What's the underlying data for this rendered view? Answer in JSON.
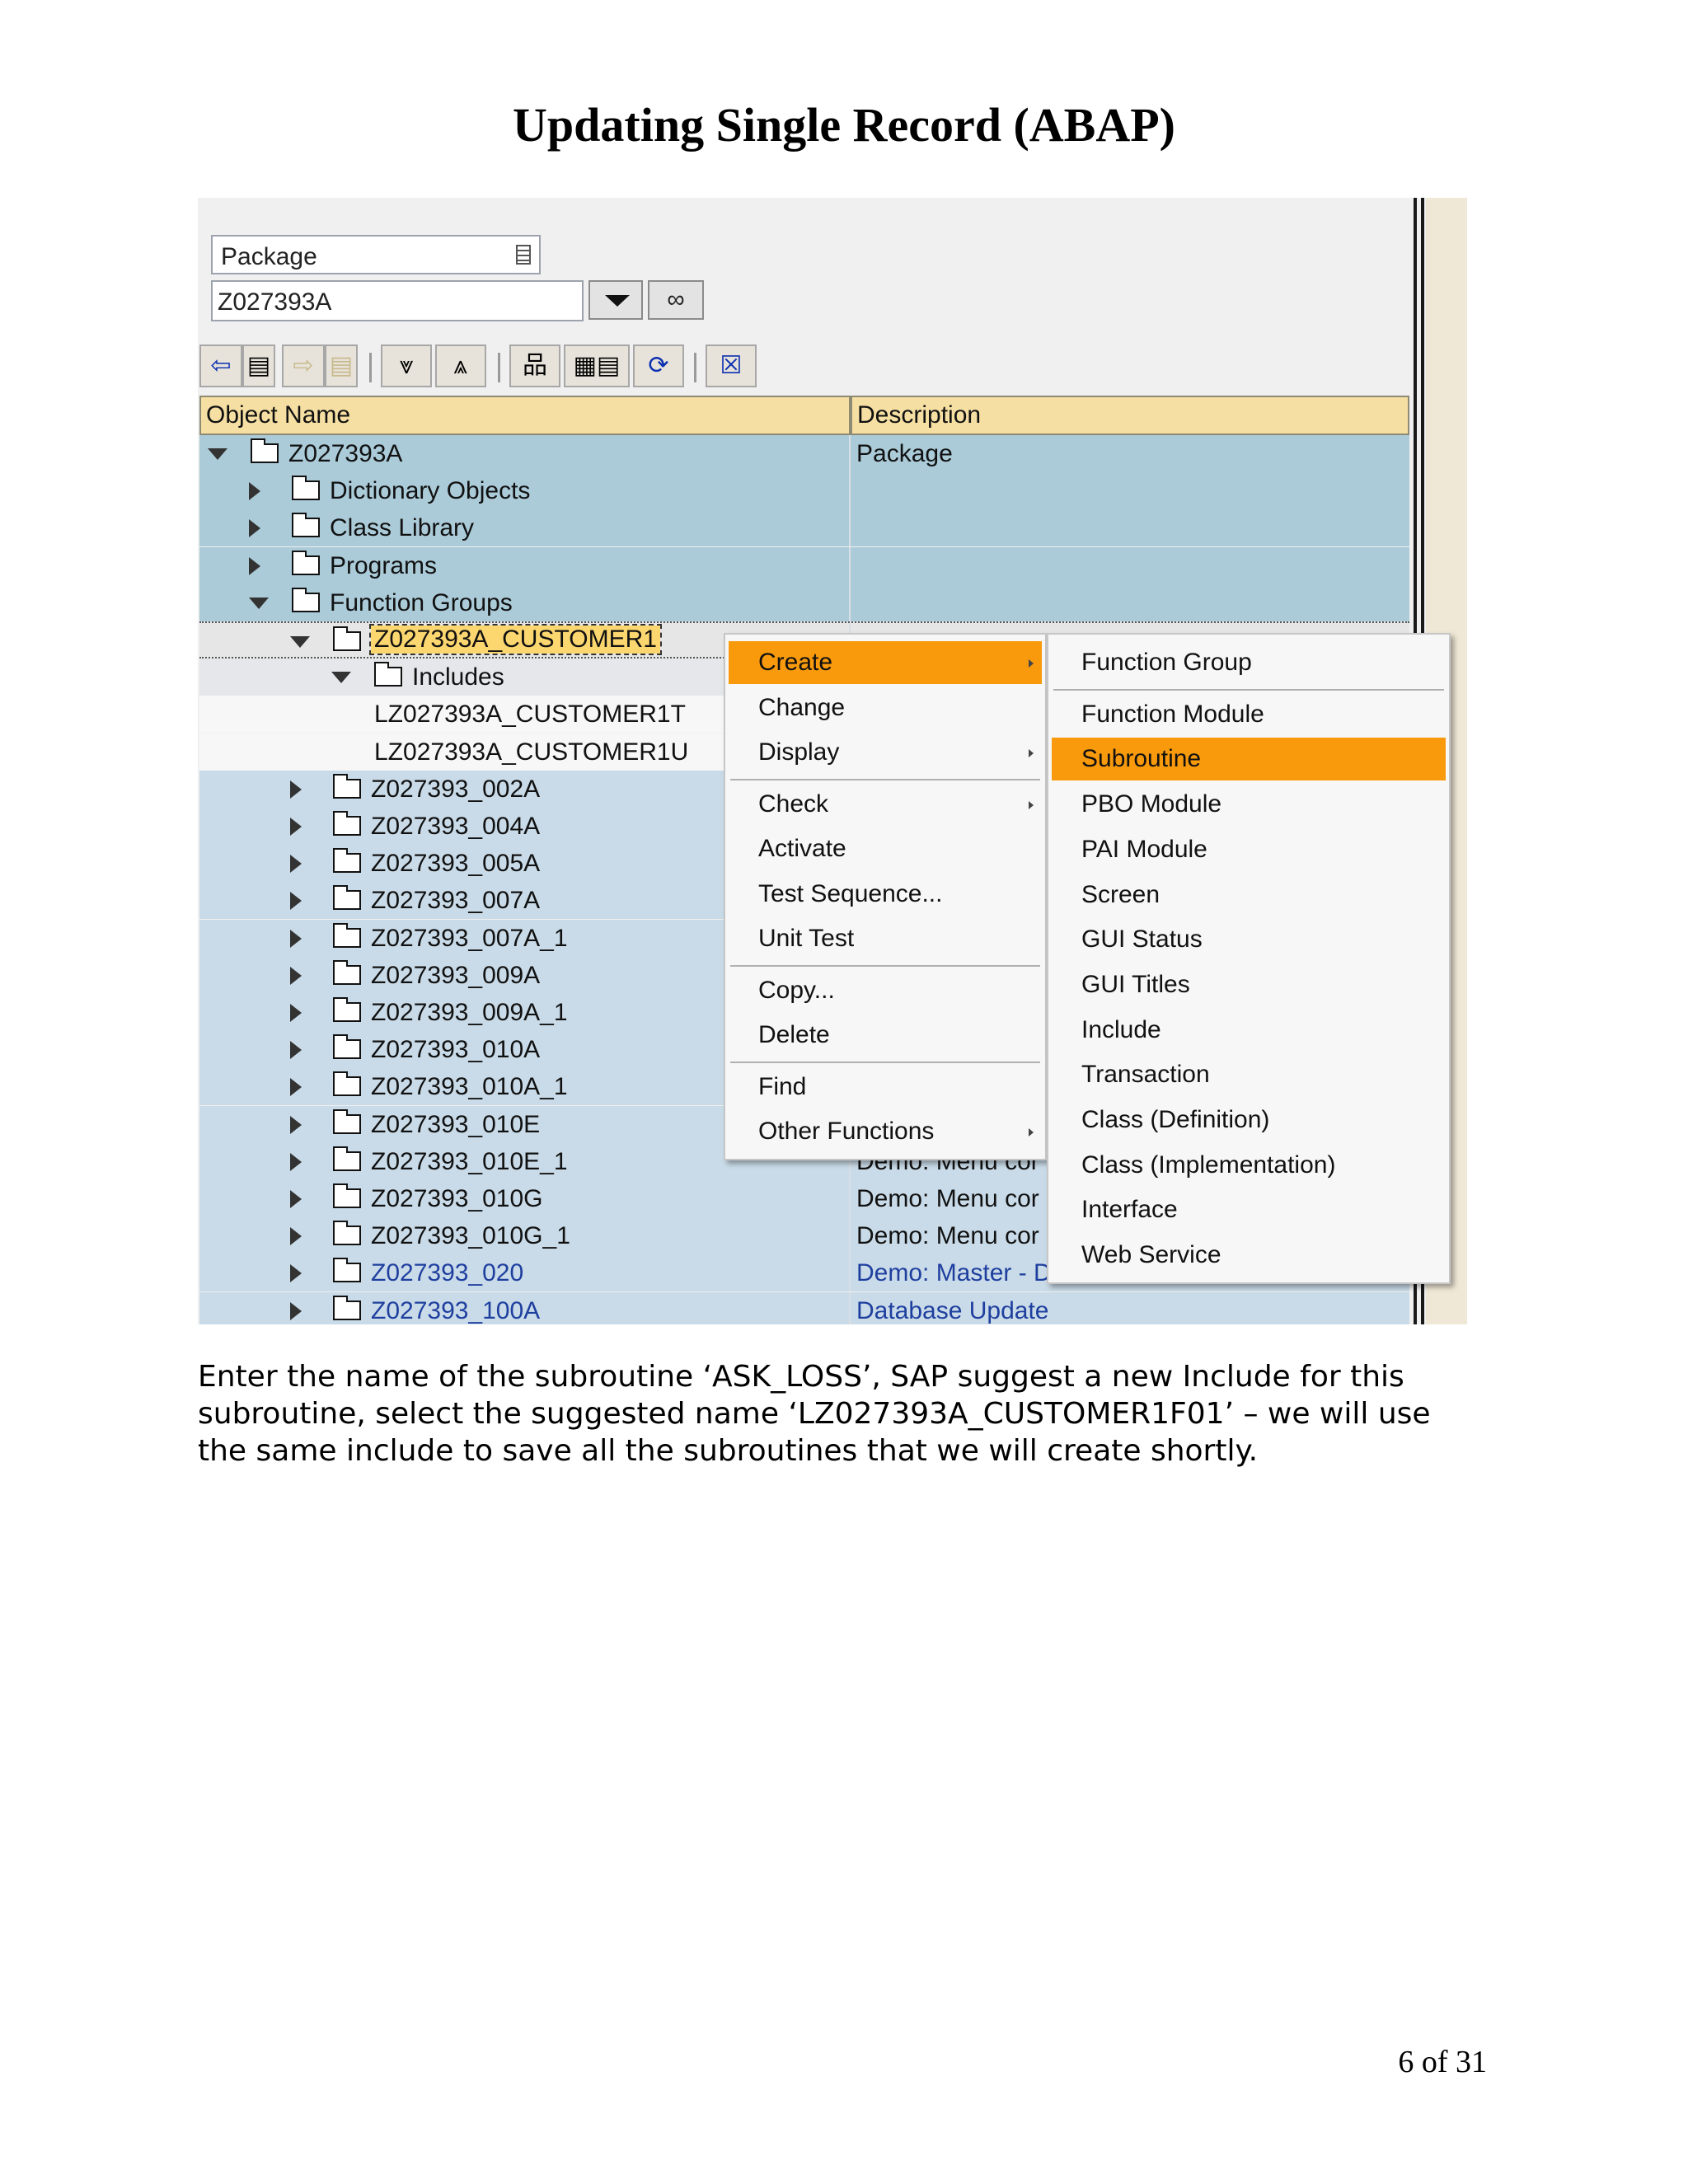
{
  "document": {
    "title": "Updating Single Record (ABAP)",
    "body_lines": [
      "Enter the name of the subroutine ‘ASK_LOSS’, SAP suggest a new Include for this",
      "subroutine, select the suggested name ‘LZ027393A_CUSTOMER1F01’ – we will use",
      "the same include to save all the subroutines that we will create shortly."
    ],
    "page_number": "6 of 31"
  },
  "repository_browser": {
    "object_type_select": "Package",
    "package_input": "Z027393A",
    "columns": {
      "object_name": "Object Name",
      "description": "Description"
    },
    "tree": [
      {
        "level": 0,
        "label": "Z027393A",
        "description": "Package",
        "expander": "open",
        "folder": true,
        "style": "blue-bg"
      },
      {
        "level": 1,
        "label": "Dictionary Objects",
        "description": "",
        "expander": "closed",
        "folder": true,
        "style": "blue-bg"
      },
      {
        "level": 1,
        "label": "Class Library",
        "description": "",
        "expander": "closed",
        "folder": true,
        "style": "blue-bg"
      },
      {
        "level": 1,
        "label": "Programs",
        "description": "",
        "expander": "closed",
        "folder": true,
        "style": "blue-bg"
      },
      {
        "level": 1,
        "label": "Function Groups",
        "description": "",
        "expander": "open",
        "folder": true,
        "style": "blue-bg"
      },
      {
        "level": 2,
        "label": "Z027393A_CUSTOMER1",
        "description": "",
        "expander": "open",
        "folder": true,
        "style": "selected"
      },
      {
        "level": 3,
        "label": "Includes",
        "description": "",
        "expander": "open",
        "folder": true,
        "style": "grey-bg"
      },
      {
        "level": 4,
        "label": "LZ027393A_CUSTOMER1T",
        "description": "",
        "expander": "none",
        "folder": false,
        "style": "white-bg"
      },
      {
        "level": 4,
        "label": "LZ027393A_CUSTOMER1U",
        "description": "",
        "expander": "none",
        "folder": false,
        "style": "white-bg"
      },
      {
        "level": 2,
        "label": "Z027393_002A",
        "description": "",
        "expander": "closed",
        "folder": true,
        "style": "lblue-bg"
      },
      {
        "level": 2,
        "label": "Z027393_004A",
        "description": "",
        "expander": "closed",
        "folder": true,
        "style": "lblue-bg"
      },
      {
        "level": 2,
        "label": "Z027393_005A",
        "description": "",
        "expander": "closed",
        "folder": true,
        "style": "lblue-bg"
      },
      {
        "level": 2,
        "label": "Z027393_007A",
        "description": "",
        "expander": "closed",
        "folder": true,
        "style": "lblue-bg"
      },
      {
        "level": 2,
        "label": "Z027393_007A_1",
        "description": "",
        "expander": "closed",
        "folder": true,
        "style": "lblue-bg"
      },
      {
        "level": 2,
        "label": "Z027393_009A",
        "description": "",
        "expander": "closed",
        "folder": true,
        "style": "lblue-bg"
      },
      {
        "level": 2,
        "label": "Z027393_009A_1",
        "description": "",
        "expander": "closed",
        "folder": true,
        "style": "lblue-bg"
      },
      {
        "level": 2,
        "label": "Z027393_010A",
        "description": "",
        "expander": "closed",
        "folder": true,
        "style": "lblue-bg"
      },
      {
        "level": 2,
        "label": "Z027393_010A_1",
        "description": "",
        "expander": "closed",
        "folder": true,
        "style": "lblue-bg"
      },
      {
        "level": 2,
        "label": "Z027393_010E",
        "description": "",
        "expander": "closed",
        "folder": true,
        "style": "lblue-bg"
      },
      {
        "level": 2,
        "label": "Z027393_010E_1",
        "description": "Demo: Menu cor",
        "expander": "closed",
        "folder": true,
        "style": "lblue-bg"
      },
      {
        "level": 2,
        "label": "Z027393_010G",
        "description": "Demo: Menu cor",
        "expander": "closed",
        "folder": true,
        "style": "lblue-bg"
      },
      {
        "level": 2,
        "label": "Z027393_010G_1",
        "description": "Demo: Menu cor",
        "expander": "closed",
        "folder": true,
        "style": "lblue-bg"
      },
      {
        "level": 2,
        "label": "Z027393_020",
        "description": "Demo: Master - D",
        "expander": "closed",
        "folder": true,
        "style": "lblue-bg-link"
      },
      {
        "level": 2,
        "label": "Z027393_100A",
        "description": "Database Update",
        "expander": "closed",
        "folder": true,
        "style": "lblue-bg-link"
      }
    ],
    "context_menu": [
      {
        "label": "Create",
        "submenu": true,
        "highlighted": true
      },
      {
        "label": "Change",
        "submenu": false
      },
      {
        "label": "Display",
        "submenu": true
      },
      {
        "label": "Check",
        "submenu": true,
        "sep_before": true
      },
      {
        "label": "Activate",
        "submenu": false
      },
      {
        "label": "Test Sequence...",
        "submenu": false
      },
      {
        "label": "Unit Test",
        "submenu": false
      },
      {
        "label": "Copy...",
        "submenu": false,
        "sep_before": true
      },
      {
        "label": "Delete",
        "submenu": false
      },
      {
        "label": "Find",
        "submenu": false,
        "sep_before": true
      },
      {
        "label": "Other Functions",
        "submenu": true
      }
    ],
    "create_submenu": [
      {
        "label": "Function Group"
      },
      {
        "label": "Function Module",
        "sep_before": true
      },
      {
        "label": "Subroutine",
        "highlighted": true
      },
      {
        "label": "PBO Module"
      },
      {
        "label": "PAI Module"
      },
      {
        "label": "Screen"
      },
      {
        "label": "GUI Status"
      },
      {
        "label": "GUI Titles"
      },
      {
        "label": "Include"
      },
      {
        "label": "Transaction"
      },
      {
        "label": "Class (Definition)"
      },
      {
        "label": "Class (Implementation)"
      },
      {
        "label": "Interface"
      },
      {
        "label": "Web Service"
      }
    ],
    "toolbar_icons": [
      "back-icon",
      "forward-icon",
      "expand-all-icon",
      "collapse-all-icon",
      "hierarchy-icon",
      "display-object-list-icon",
      "refresh-icon",
      "close-icon"
    ],
    "colors": {
      "accent": "#f99a0c",
      "header": "#f5dfa2",
      "tree_blue": "#abcbd9",
      "tree_light": "#c9dbe8",
      "link": "#1f3f9f"
    }
  }
}
